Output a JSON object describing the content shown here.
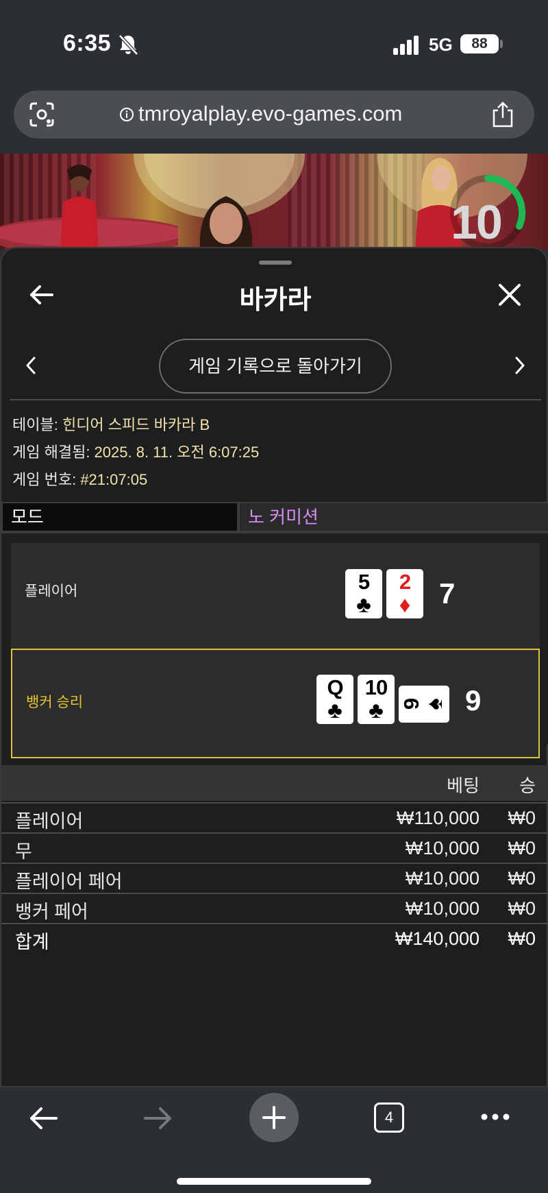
{
  "status_bar": {
    "time": "6:35",
    "network": "5G",
    "battery": "88"
  },
  "browser": {
    "url": "tmroyalplay.evo-games.com",
    "tab_count": "4"
  },
  "video": {
    "timer": "10"
  },
  "sheet": {
    "title": "바카라",
    "back_to_history": "게임 기록으로 돌아가기",
    "info": [
      {
        "label": "테이블: ",
        "value": "힌디어 스피드 바카라 B"
      },
      {
        "label": "게임 해결됨: ",
        "value": "2025. 8. 11. 오전 6:07:25"
      },
      {
        "label": "게임 번호: ",
        "value": "#21:07:05"
      }
    ],
    "mode": {
      "label": "모드",
      "value": "노 커미션"
    },
    "player": {
      "label": "플레이어",
      "score": "7",
      "cards": [
        {
          "rank": "5",
          "suit": "♣"
        },
        {
          "rank": "2",
          "suit": "♦"
        }
      ]
    },
    "banker": {
      "label": "뱅커 승리",
      "score": "9",
      "cards": [
        {
          "rank": "Q",
          "suit": "♣"
        },
        {
          "rank": "10",
          "suit": "♣"
        },
        {
          "rank": "9",
          "suit": "♠"
        }
      ]
    },
    "bets": {
      "headers": {
        "bet": "베팅",
        "win": "승"
      },
      "rows": [
        {
          "name": "플레이어",
          "amount": "₩110,000",
          "win": "₩0"
        },
        {
          "name": "무",
          "amount": "₩10,000",
          "win": "₩0"
        },
        {
          "name": "플레이어 페어",
          "amount": "₩10,000",
          "win": "₩0"
        },
        {
          "name": "뱅커 페어",
          "amount": "₩10,000",
          "win": "₩0"
        }
      ],
      "total": {
        "name": "합계",
        "amount": "₩140,000",
        "win": "₩0"
      }
    }
  },
  "colors": {
    "accent_border": "#e0c33a",
    "mode_value": "#d78cf2",
    "timer_ring": "#1db954"
  },
  "icons": [
    "bell-slash-icon",
    "signal-icon",
    "battery-icon",
    "lens-icon",
    "info-icon",
    "share-icon",
    "back-arrow-icon",
    "close-icon",
    "chevron-left-icon",
    "chevron-right-icon",
    "plus-icon",
    "ellipsis-icon"
  ]
}
